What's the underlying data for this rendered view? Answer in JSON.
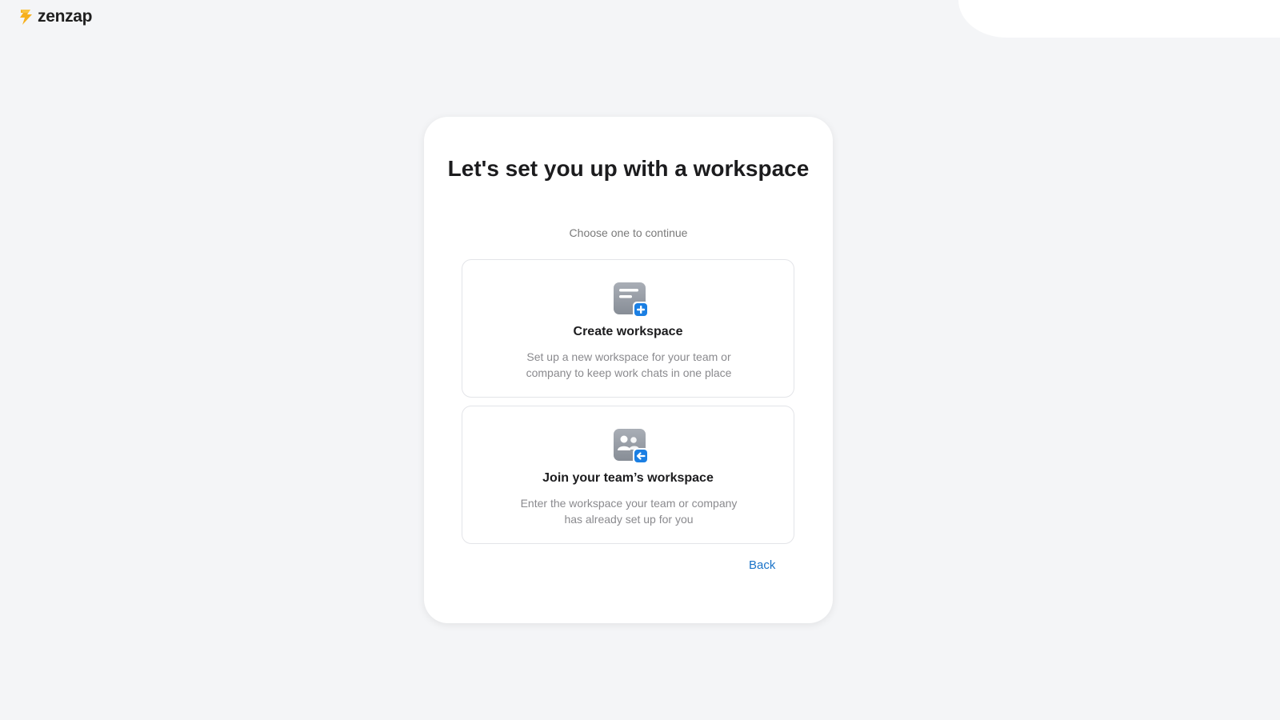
{
  "brand": {
    "name": "zenzap",
    "logo_icon": "lightning-bolt-icon",
    "accent_color": "#f6b01e"
  },
  "card": {
    "title": "Let's set you up with a workspace",
    "subtitle": "Choose one to continue"
  },
  "options": [
    {
      "icon": "document-plus-icon",
      "title": "Create workspace",
      "description": "Set up a new workspace for your team or company to keep work chats in one place"
    },
    {
      "icon": "team-join-icon",
      "title": "Join your team’s workspace",
      "description": "Enter the workspace your team or company has already set up for you"
    }
  ],
  "actions": {
    "back_label": "Back"
  },
  "colors": {
    "background": "#f4f5f7",
    "card": "#ffffff",
    "link": "#1a73c8",
    "icon_badge": "#1b7fe3",
    "icon_gray": "#9aa0a8"
  }
}
